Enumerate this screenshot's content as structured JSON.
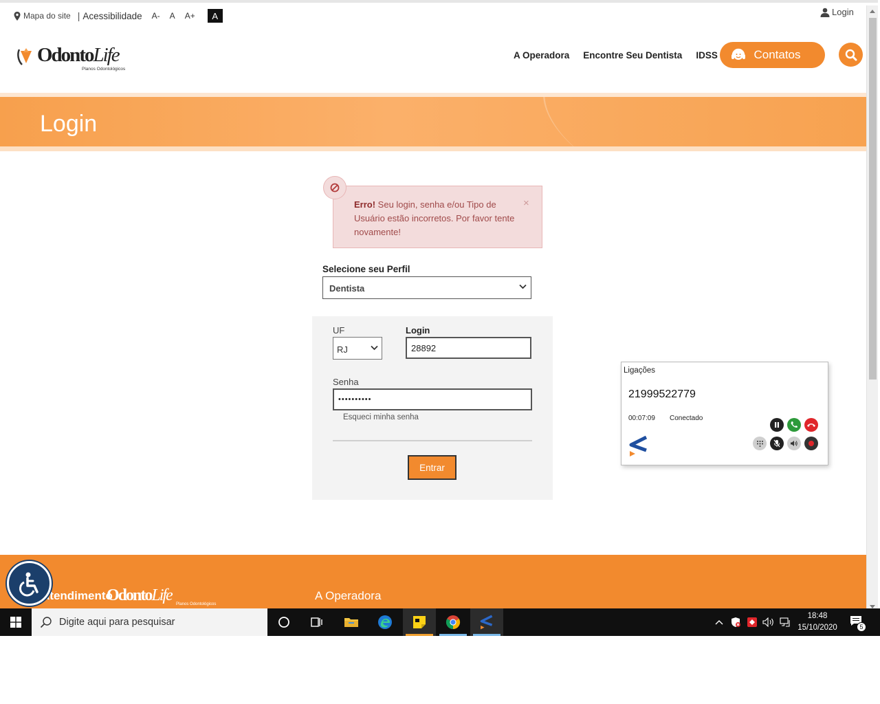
{
  "topbar": {
    "sitemap": "Mapa do site",
    "separator": "|",
    "accessibility": "Acessibilidade",
    "font_decrease": "A-",
    "font_normal": "A",
    "font_increase": "A+",
    "contrast": "A",
    "login": "Login"
  },
  "header": {
    "logo_brand": "Odonto",
    "logo_brand_suffix": "Life",
    "logo_tagline": "Planos Odontológicos",
    "nav": {
      "operadora": "A Operadora",
      "dentista": "Encontre Seu Dentista",
      "idss": "IDSS",
      "contatos": "Contatos"
    }
  },
  "banner": {
    "title": "Login"
  },
  "alert": {
    "strong": "Erro!",
    "message": " Seu login, senha e/ou Tipo de Usuário estão incorretos. Por favor tente novamente!",
    "close": "×"
  },
  "form": {
    "perfil_label": "Selecione seu Perfil",
    "perfil_value": "Dentista",
    "uf_label": "UF",
    "uf_value": "RJ",
    "login_label": "Login",
    "login_value": "28892",
    "senha_label": "Senha",
    "senha_value": "••••••••••",
    "forgot": "Esqueci minha senha",
    "submit": "Entrar"
  },
  "calls": {
    "title": "Ligações",
    "number": "21999522779",
    "time": "00:07:09",
    "status": "Conectado"
  },
  "footer": {
    "atendimento": "Atendimento",
    "logo_brand": "Odonto",
    "logo_brand_suffix": "Life",
    "logo_tagline": "Planos Odontológicos",
    "operadora": "A Operadora"
  },
  "taskbar": {
    "search_placeholder": "Digite aqui para pesquisar",
    "time": "18:48",
    "date": "15/10/2020",
    "notifications": "5"
  },
  "colors": {
    "brand_orange": "#f28a2e",
    "error_bg": "#f3dcdc",
    "error_text": "#a04a4a",
    "taskbar_bg": "#101010"
  }
}
